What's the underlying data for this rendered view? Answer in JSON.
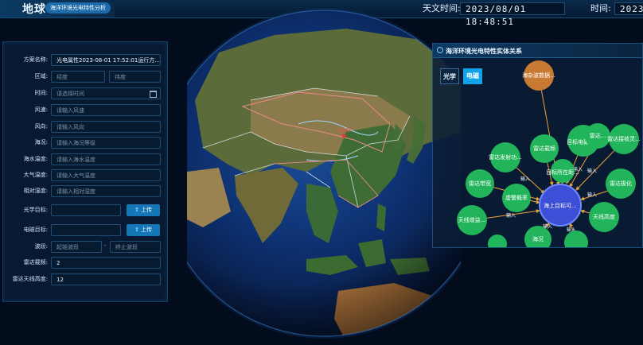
{
  "header": {
    "app_title": "地球",
    "app_subtitle": "海洋环境光电特性分析",
    "astro_time_label": "天文时间:",
    "astro_time_value": "2023/08/01 18:48:51",
    "time_label": "时间:",
    "time_value": "2023/"
  },
  "form": {
    "plan_label": "方案名称:",
    "plan_value": "光电属性2023-08-01 17:52:01运行方...",
    "region_label": "区域:",
    "lon_placeholder": "经度",
    "lat_placeholder": "纬度",
    "time_label": "时间:",
    "time_placeholder": "请选择时间",
    "wind_speed_label": "风速:",
    "wind_speed_placeholder": "请输入风速",
    "wind_dir_label": "风向:",
    "wind_dir_placeholder": "请输入风向",
    "sea_state_label": "海况:",
    "sea_state_placeholder": "请输入海况等级",
    "sea_temp_label": "海水温度:",
    "sea_temp_placeholder": "请输入海水温度",
    "air_temp_label": "大气温度:",
    "air_temp_placeholder": "请输入大气温度",
    "humidity_label": "相对湿度:",
    "humidity_placeholder": "请输入相对湿度",
    "optical_target_label": "光学目标:",
    "em_target_label": "电磁目标:",
    "upload_label": "上传",
    "band_label": "波段:",
    "band_start_placeholder": "起始波段",
    "band_separator": "-",
    "band_end_placeholder": "终止波段",
    "radar_band_label": "雷达载频:",
    "radar_band_value": "2",
    "antenna_height_label": "雷达天线高度:",
    "antenna_height_value": "12"
  },
  "graph_panel": {
    "title": "海洋环境光电特性实体关系",
    "tabs": [
      "光学",
      "电磁"
    ],
    "active_tab": 1,
    "edge_label": "输入",
    "center_node": "海上目标可...",
    "nodes": [
      "海杂波数据...",
      "雷达载频",
      "雷达发射功...",
      "目标电磁散...",
      "雷达...",
      "雷达接收灵...",
      "目标所在距...",
      "雷达带宽",
      "虚警概率",
      "雷达极化",
      "天线增益...",
      "天线高度",
      "海况"
    ]
  },
  "colors": {
    "node_green": "#22b45a",
    "center_blue": "#3d4fd6",
    "orange_node": "#c87a32",
    "accent": "#1a8fe0"
  },
  "map": {
    "marker_label": "北京市"
  }
}
